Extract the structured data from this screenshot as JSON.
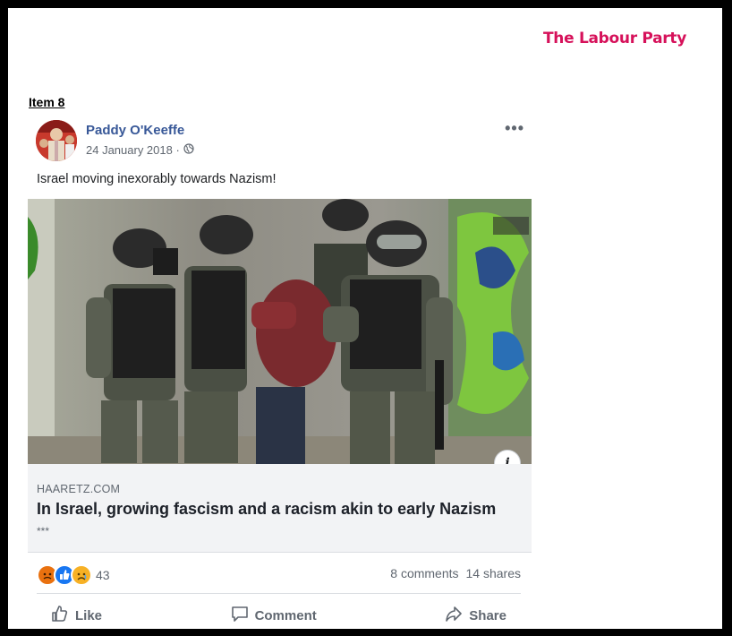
{
  "brand": {
    "name": "The Labour Party",
    "color": "#d6115a"
  },
  "item_label": "Item 8",
  "post": {
    "author": "Paddy O'Keeffe",
    "date": "24 January 2018 · ",
    "audience_icon": "globe-icon",
    "more_label": "•••",
    "text": "Israel moving inexorably towards Nazism!",
    "link": {
      "domain": "HAARETZ.COM",
      "title": "In Israel, growing fascism and a racism akin to early Nazism",
      "description": "***",
      "info_label": "i"
    },
    "reactions": {
      "types": [
        "angry-reaction-icon",
        "like-reaction-icon",
        "sad-reaction-icon"
      ],
      "count": "43"
    },
    "comments": "8 comments",
    "shares": "14 shares",
    "actions": {
      "like": "Like",
      "comment": "Comment",
      "share": "Share"
    }
  }
}
